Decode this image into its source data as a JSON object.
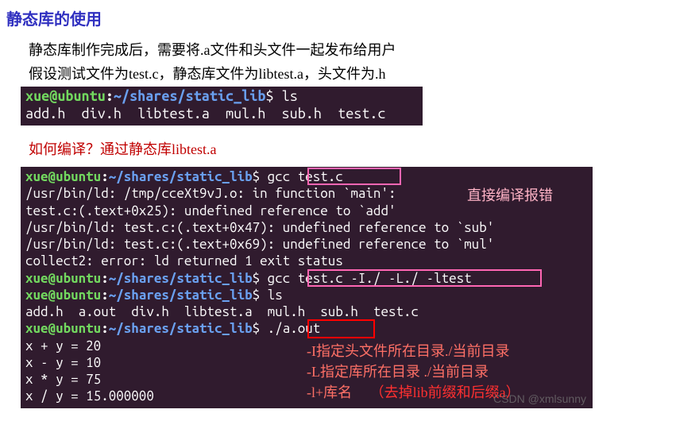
{
  "title": "静态库的使用",
  "desc1": "静态库制作完成后，需要将.a文件和头文件一起发布给用户",
  "desc2": "假设测试文件为test.c，静态库文件为libtest.a，头文件为.h",
  "section": "如何编译？通过静态库libtest.a",
  "term1": {
    "prompt_user": "xue@ubuntu",
    "prompt_sep": ":",
    "prompt_path": "~/shares/static_lib",
    "prompt_end": "$ ",
    "cmd": "ls",
    "ls_out": "add.h  div.h  libtest.a  mul.h  sub.h  test.c"
  },
  "term2": {
    "prompt_user": "xue@ubuntu",
    "prompt_sep": ":",
    "prompt_path": "~/shares/static_lib",
    "prompt_end": "$ ",
    "cmd1": "gcc test.c",
    "err1": "/usr/bin/ld: /tmp/cceXt9vJ.o: in function `main':",
    "err2": "test.c:(.text+0x25): undefined reference to `add'",
    "err3": "/usr/bin/ld: test.c:(.text+0x47): undefined reference to `sub'",
    "err4": "/usr/bin/ld: test.c:(.text+0x69): undefined reference to `mul'",
    "err5": "collect2: error: ld returned 1 exit status",
    "cmd2": "gcc test.c -I./ -L./ -ltest",
    "cmd3": "ls",
    "ls_out": "add.h  a.out  div.h  libtest.a  mul.h  sub.h  test.c",
    "cmd4": "./a.out",
    "out1": "x + y = 20",
    "out2": "x - y = 10",
    "out3": "x * y = 75",
    "out4": "x / y = 15.000000"
  },
  "anno": {
    "pink1": "直接编译报错",
    "red_i": "-I指定头文件所在目录./当前目录",
    "red_l": "-L指定库所在目录 ./当前目录",
    "red_lname": "-l+库名",
    "red_note": "（去掉lib前缀和后缀a）"
  },
  "watermark": "CSDN @xmlsunny"
}
